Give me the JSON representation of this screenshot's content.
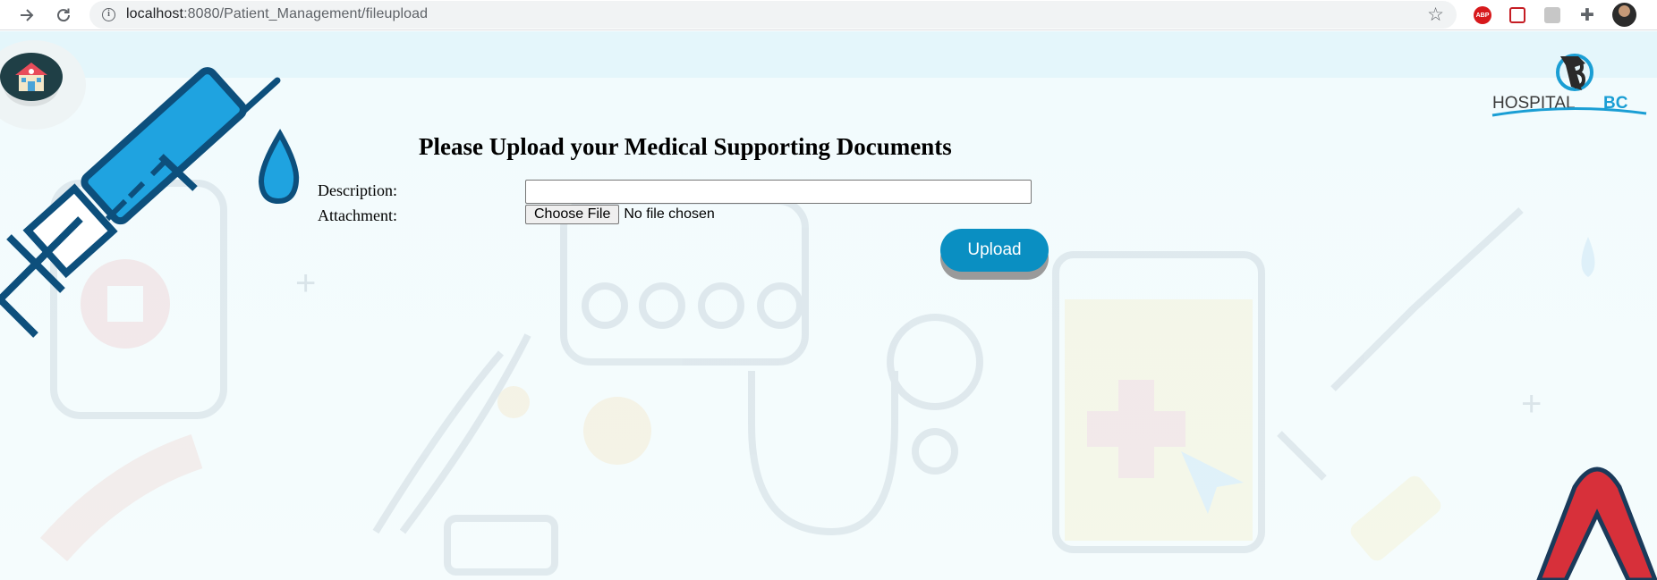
{
  "browser": {
    "url_host": "localhost",
    "url_path": ":8080/Patient_Management/fileupload"
  },
  "extensions": {
    "abp_label": "ABP"
  },
  "logo": {
    "text_main": "HOSPITAL",
    "text_accent": "BC"
  },
  "form": {
    "title": "Please Upload your Medical Supporting Documents",
    "description_label": "Description:",
    "description_value": "",
    "attachment_label": "Attachment:",
    "choose_file_label": "Choose File",
    "file_status": "No file chosen",
    "upload_label": "Upload"
  },
  "colors": {
    "upload_button": "#0a8fc2",
    "page_background": "#f2fbfd",
    "syringe_blue": "#1fa3e0",
    "syringe_outline": "#0d4f7c"
  },
  "icons": {
    "nav_forward": "arrow-right-icon",
    "nav_reload": "reload-icon",
    "site_info": "info-icon",
    "bookmark": "star-icon",
    "home": "hospital-home-icon",
    "syringe": "syringe-icon",
    "ribbon": "awareness-ribbon-icon"
  }
}
